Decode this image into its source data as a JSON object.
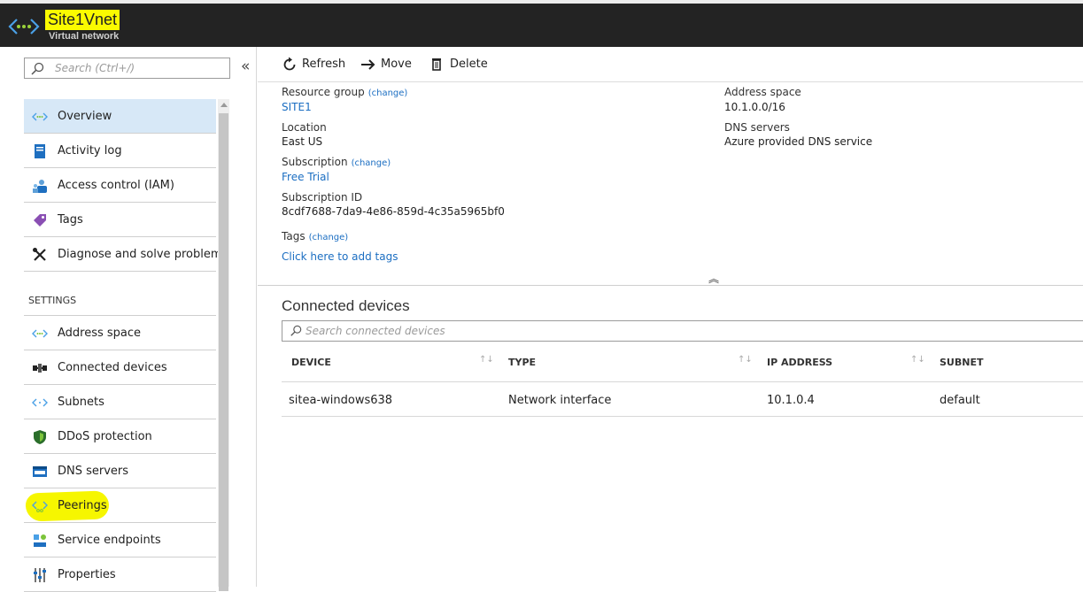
{
  "header": {
    "title": "Site1Vnet",
    "subtitle": "Virtual network"
  },
  "sidebar": {
    "search_placeholder": "Search (Ctrl+/)",
    "collapse_glyph": "«",
    "items_top": [
      {
        "label": "Overview",
        "icon": "vnet-icon"
      },
      {
        "label": "Activity log",
        "icon": "activity-log-icon"
      },
      {
        "label": "Access control (IAM)",
        "icon": "iam-icon"
      },
      {
        "label": "Tags",
        "icon": "tag-icon"
      },
      {
        "label": "Diagnose and solve problems",
        "icon": "wrench-icon"
      }
    ],
    "settings_header": "SETTINGS",
    "items_settings": [
      {
        "label": "Address space",
        "icon": "vnet-icon"
      },
      {
        "label": "Connected devices",
        "icon": "connected-devices-icon"
      },
      {
        "label": "Subnets",
        "icon": "subnet-icon"
      },
      {
        "label": "DDoS protection",
        "icon": "shield-icon"
      },
      {
        "label": "DNS servers",
        "icon": "dns-icon"
      },
      {
        "label": "Peerings",
        "icon": "peering-icon"
      },
      {
        "label": "Service endpoints",
        "icon": "service-endpoint-icon"
      },
      {
        "label": "Properties",
        "icon": "properties-icon"
      }
    ]
  },
  "toolbar": {
    "refresh": "Refresh",
    "move": "Move",
    "delete": "Delete"
  },
  "essentials": {
    "resource_group_label": "Resource group",
    "resource_group_value": "SITE1",
    "location_label": "Location",
    "location_value": "East US",
    "subscription_label": "Subscription",
    "subscription_value": "Free Trial",
    "subscription_id_label": "Subscription ID",
    "subscription_id_value": "8cdf7688-7da9-4e86-859d-4c35a5965bf0",
    "tags_label": "Tags",
    "tags_link": "Click here to add tags",
    "change": "(change)",
    "address_space_label": "Address space",
    "address_space_value": "10.1.0.0/16",
    "dns_servers_label": "DNS servers",
    "dns_servers_value": "Azure provided DNS service",
    "collapse_glyph": "︽"
  },
  "connected_devices": {
    "title": "Connected devices",
    "search_placeholder": "Search connected devices",
    "columns": [
      "DEVICE",
      "TYPE",
      "IP ADDRESS",
      "SUBNET"
    ],
    "sort_glyph": "↑↓",
    "rows": [
      [
        "sitea-windows638",
        "Network interface",
        "10.1.0.4",
        "default"
      ]
    ]
  },
  "colors": {
    "highlight": "#f6f600",
    "link": "#1b6ec2",
    "active_item": "#d7e8f7"
  }
}
